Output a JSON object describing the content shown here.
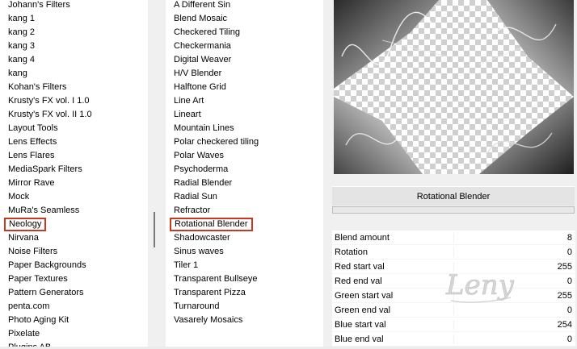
{
  "categories": {
    "items": [
      "Johann's Filters",
      "kang 1",
      "kang 2",
      "kang 3",
      "kang 4",
      "kang",
      "Kohan's Filters",
      "Krusty's FX vol. I 1.0",
      "Krusty's FX vol. II 1.0",
      "Layout Tools",
      "Lens Effects",
      "Lens Flares",
      "MediaSpark Filters",
      "Mirror Rave",
      "Mock",
      "MuRa's Seamless",
      "Neology",
      "Nirvana",
      "Noise Filters",
      "Paper Backgrounds",
      "Paper Textures",
      "Pattern Generators",
      "penta.com",
      "Photo Aging Kit",
      "Pixelate",
      "Plugins AB"
    ],
    "selected": "Neology"
  },
  "filters": {
    "items": [
      "A Different Sin",
      "Blend Mosaic",
      "Checkered Tiling",
      "Checkermania",
      "Digital Weaver",
      "H/V Blender",
      "Halftone Grid",
      "Line Art",
      "Lineart",
      "Mountain Lines",
      "Polar checkered tiling",
      "Polar Waves",
      "Psychoderma",
      "Radial Blender",
      "Radial Sun",
      "Refractor",
      "Rotational Blender",
      "Shadowcaster",
      "Sinus waves",
      "Tiler 1",
      "Transparent Bullseye",
      "Transparent Pizza",
      "Turnaround",
      "Vasarely Mosaics"
    ],
    "selected": "Rotational Blender"
  },
  "preview": {
    "title": "Rotational Blender"
  },
  "params": [
    {
      "label": "Blend amount",
      "value": "8"
    },
    {
      "label": "Rotation",
      "value": "0"
    },
    {
      "label": "Red start val",
      "value": "255"
    },
    {
      "label": "Red end val",
      "value": "0"
    },
    {
      "label": "Green start val",
      "value": "255"
    },
    {
      "label": "Green end val",
      "value": "0"
    },
    {
      "label": "Blue start val",
      "value": "254"
    },
    {
      "label": "Blue end val",
      "value": "0"
    }
  ],
  "watermark": {
    "text": "Leny"
  },
  "colors": {
    "selection_border": "#c8381f"
  }
}
